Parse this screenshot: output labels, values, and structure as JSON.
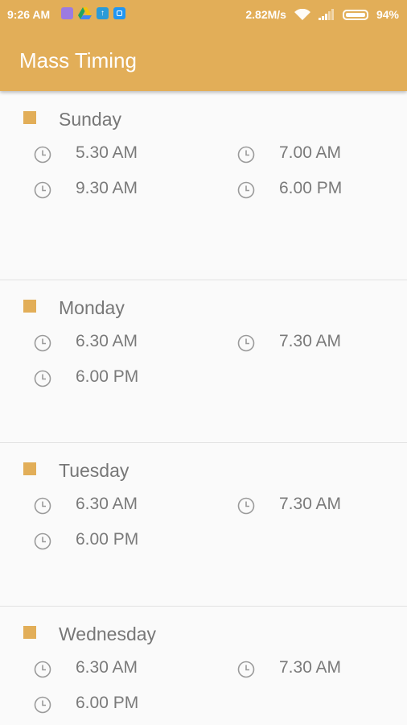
{
  "status_bar": {
    "time": "9:26 AM",
    "speed": "2.82M/s",
    "battery": "94%",
    "app_icons": [
      "app-icon-purple",
      "drive-icon",
      "upload-icon",
      "message-icon"
    ]
  },
  "header": {
    "title": "Mass Timing"
  },
  "colors": {
    "accent": "#e2ae58",
    "text": "#777777",
    "divider": "#e2e2e2"
  },
  "days": [
    {
      "name": "Sunday",
      "times": [
        "5.30 AM",
        "7.00 AM",
        "9.30 AM",
        "6.00 PM"
      ]
    },
    {
      "name": "Monday",
      "times": [
        "6.30 AM",
        "7.30 AM",
        "6.00 PM"
      ]
    },
    {
      "name": "Tuesday",
      "times": [
        "6.30 AM",
        "7.30 AM",
        "6.00 PM"
      ]
    },
    {
      "name": "Wednesday",
      "times": [
        "6.30 AM",
        "7.30 AM",
        "6.00 PM"
      ]
    }
  ]
}
